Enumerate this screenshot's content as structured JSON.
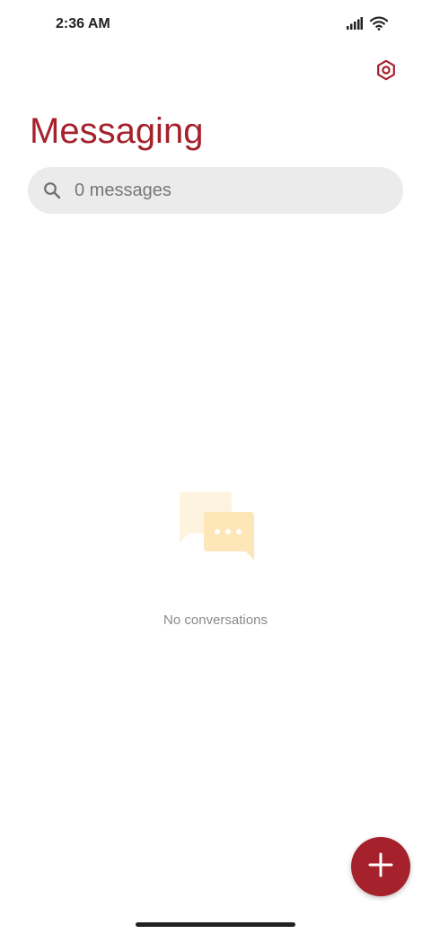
{
  "status_bar": {
    "time": "2:36 AM",
    "icons": [
      "signal-icon",
      "wifi-icon"
    ]
  },
  "header": {
    "title": "Messaging",
    "settings_icon": "settings-icon"
  },
  "search": {
    "placeholder": "0 messages",
    "icon": "search-icon"
  },
  "empty_state": {
    "icon": "chat-bubbles-icon",
    "message": "No conversations"
  },
  "fab": {
    "icon": "plus-icon"
  },
  "colors": {
    "accent": "#a5212c",
    "search_bg": "#ebebeb",
    "empty_icon_back": "#fdf3de",
    "empty_icon_front": "#fde6b8",
    "empty_text": "#8a8a8a"
  }
}
